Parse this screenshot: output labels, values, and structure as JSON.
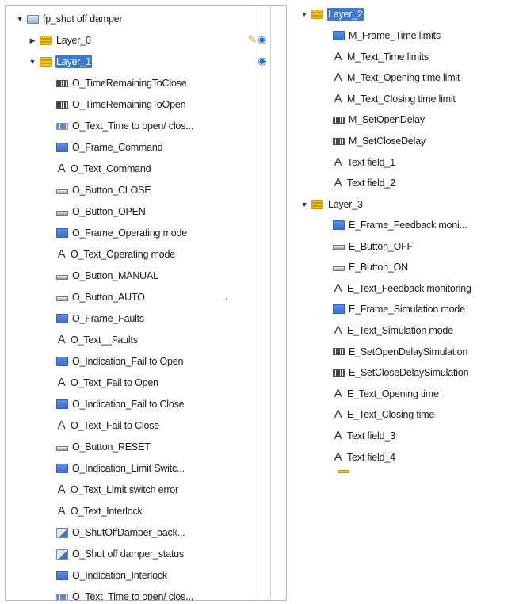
{
  "left_tree": {
    "screen": {
      "label": "fp_shut off damper",
      "icon": "screen-icon",
      "expanded": true
    },
    "layer_0": {
      "label": "Layer_0",
      "icon": "layer-icon",
      "expanded": false
    },
    "layer_1": {
      "label": "Layer_1",
      "icon": "layer-icon",
      "expanded": true,
      "selected": true
    },
    "items": [
      {
        "label": "O_TimeRemainingToClose",
        "icon": "io-field-icon"
      },
      {
        "label": "O_TimeRemainingToOpen",
        "icon": "io-field-icon"
      },
      {
        "label": "O_Text_Time to open/ clos...",
        "icon": "text-list-icon"
      },
      {
        "label": "O_Frame_Command",
        "icon": "rectangle-icon"
      },
      {
        "label": "O_Text_Command",
        "icon": "text-icon"
      },
      {
        "label": "O_Button_CLOSE",
        "icon": "button-icon"
      },
      {
        "label": "O_Button_OPEN",
        "icon": "button-icon"
      },
      {
        "label": "O_Frame_Operating mode",
        "icon": "rectangle-icon"
      },
      {
        "label": "O_Text_Operating mode",
        "icon": "text-icon"
      },
      {
        "label": "O_Button_MANUAL",
        "icon": "button-icon"
      },
      {
        "label": "O_Button_AUTO",
        "icon": "button-icon"
      },
      {
        "label": "O_Frame_Faults",
        "icon": "rectangle-icon"
      },
      {
        "label": "O_Text__Faults",
        "icon": "text-icon"
      },
      {
        "label": "O_Indication_Fail to Open",
        "icon": "rectangle-icon"
      },
      {
        "label": "O_Text_Fail to Open",
        "icon": "text-icon"
      },
      {
        "label": "O_Indication_Fail to Close",
        "icon": "rectangle-icon"
      },
      {
        "label": "O_Text_Fail to Close",
        "icon": "text-icon"
      },
      {
        "label": "O_Button_RESET",
        "icon": "button-icon"
      },
      {
        "label": "O_Indication_Limit Switc...",
        "icon": "rectangle-icon"
      },
      {
        "label": "O_Text_Limit switch error",
        "icon": "text-icon"
      },
      {
        "label": "O_Text_Interlock",
        "icon": "text-icon"
      },
      {
        "label": "O_ShutOffDamper_back...",
        "icon": "graphic-view-icon"
      },
      {
        "label": "O_Shut off damper_status",
        "icon": "graphic-view-icon"
      },
      {
        "label": "O_Indication_Interlock",
        "icon": "rectangle-icon"
      },
      {
        "label": "O_Text_Time to open/ clos...",
        "icon": "text-list-icon"
      }
    ],
    "side_icons": {
      "pencil": "pencil-icon",
      "eye": "eye-icon"
    }
  },
  "right_tree": {
    "layer_2": {
      "label": "Layer_2",
      "icon": "layer-icon",
      "expanded": true,
      "selected": true
    },
    "layer_2_items": [
      {
        "label": "M_Frame_Time limits",
        "icon": "rectangle-icon"
      },
      {
        "label": "M_Text_Time limits",
        "icon": "text-icon"
      },
      {
        "label": "M_Text_Opening time limit",
        "icon": "text-icon"
      },
      {
        "label": "M_Text_Closing time limit",
        "icon": "text-icon"
      },
      {
        "label": "M_SetOpenDelay",
        "icon": "io-field-icon"
      },
      {
        "label": "M_SetCloseDelay",
        "icon": "io-field-icon"
      },
      {
        "label": "Text field_1",
        "icon": "text-icon"
      },
      {
        "label": "Text field_2",
        "icon": "text-icon"
      }
    ],
    "layer_3": {
      "label": "Layer_3",
      "icon": "layer-icon",
      "expanded": true
    },
    "layer_3_items": [
      {
        "label": "E_Frame_Feedback moni...",
        "icon": "rectangle-icon"
      },
      {
        "label": "E_Button_OFF",
        "icon": "button-icon"
      },
      {
        "label": "E_Button_ON",
        "icon": "button-icon"
      },
      {
        "label": "E_Text_Feedback monitoring",
        "icon": "text-icon"
      },
      {
        "label": "E_Frame_Simulation mode",
        "icon": "rectangle-icon"
      },
      {
        "label": "E_Text_Simulation mode",
        "icon": "text-icon"
      },
      {
        "label": "E_SetOpenDelaySimulation",
        "icon": "io-field-icon"
      },
      {
        "label": "E_SetCloseDelaySimulation",
        "icon": "io-field-icon"
      },
      {
        "label": "E_Text_Opening time",
        "icon": "text-icon"
      },
      {
        "label": "E_Text_Closing time",
        "icon": "text-icon"
      },
      {
        "label": "Text field_3",
        "icon": "text-icon"
      },
      {
        "label": "Text field_4",
        "icon": "text-icon"
      }
    ]
  },
  "colors": {
    "selection": "#3c78d8",
    "layer_icon": "#f0c419",
    "border": "#b9b9b9"
  }
}
